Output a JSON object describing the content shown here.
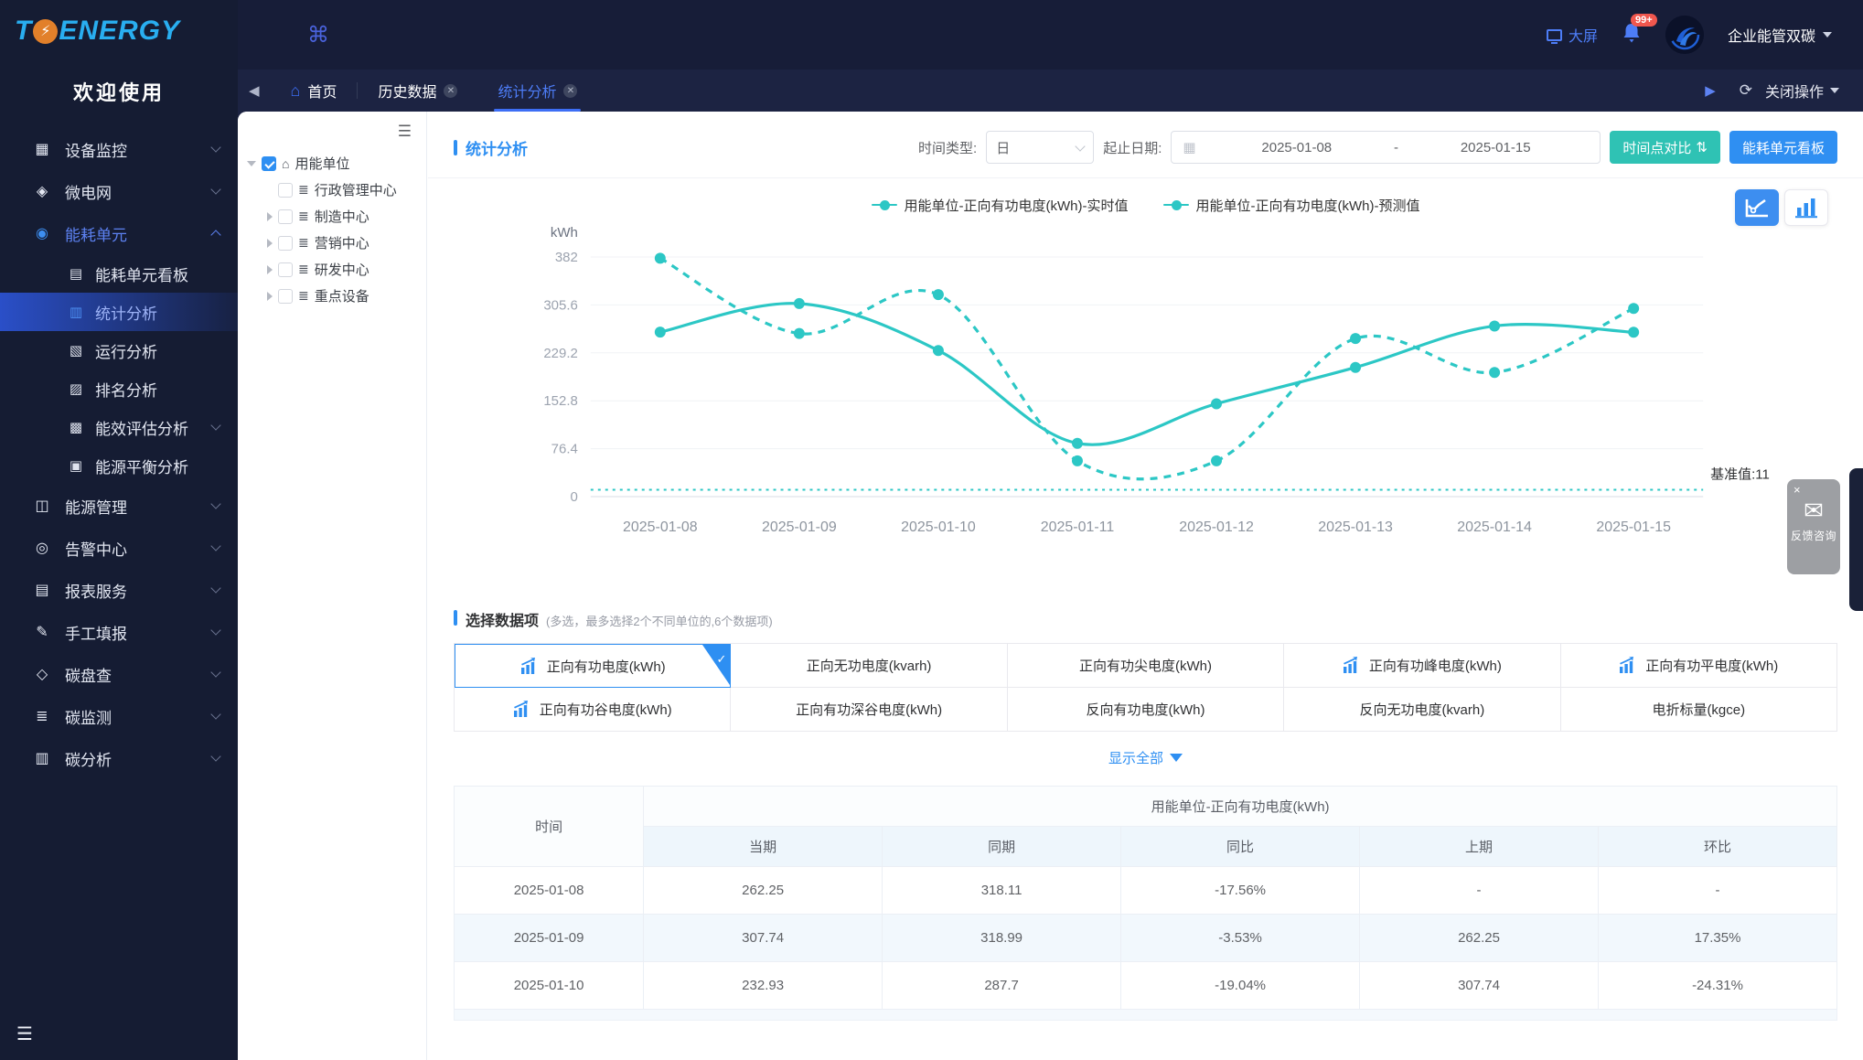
{
  "colors": {
    "accent_blue": "#2e8ff2",
    "teal": "#2cc7c5",
    "teal_button": "#2fc2b4",
    "sidebar_bg": "#151c33",
    "topbar_bg": "#171d38",
    "tabbar_bg": "#1c2342",
    "active_tab": "#4d7df7",
    "green": "#23a455",
    "red": "#e25050",
    "badge_red": "#f0574e"
  },
  "brand": {
    "logo_left": "T",
    "logo_bolt": "⚡",
    "logo_right": "ENERGY",
    "welcome": "欢迎使用"
  },
  "sidebar": {
    "collapse_icon": "☰",
    "items": [
      {
        "key": "device-monitor",
        "label": "设备监控",
        "icon": "▦",
        "chevron": "down"
      },
      {
        "key": "microgrid",
        "label": "微电网",
        "icon": "◈",
        "chevron": "down"
      },
      {
        "key": "energy-unit",
        "label": "能耗单元",
        "icon": "◉",
        "chevron": "up",
        "active": true,
        "children": [
          {
            "key": "energy-unit-board",
            "label": "能耗单元看板",
            "icon": "▤"
          },
          {
            "key": "statistical-analysis",
            "label": "统计分析",
            "icon": "▥",
            "active": true
          },
          {
            "key": "operation-analysis",
            "label": "运行分析",
            "icon": "▧"
          },
          {
            "key": "ranking-analysis",
            "label": "排名分析",
            "icon": "▨"
          },
          {
            "key": "efficiency-evaluation",
            "label": "能效评估分析",
            "icon": "▩",
            "chevron": "down"
          },
          {
            "key": "energy-balance",
            "label": "能源平衡分析",
            "icon": "▣"
          }
        ]
      },
      {
        "key": "energy-management",
        "label": "能源管理",
        "icon": "◫",
        "chevron": "down"
      },
      {
        "key": "alarm-center",
        "label": "告警中心",
        "icon": "◎",
        "chevron": "down"
      },
      {
        "key": "report-service",
        "label": "报表服务",
        "icon": "▤",
        "chevron": "down"
      },
      {
        "key": "manual-fill",
        "label": "手工填报",
        "icon": "✎",
        "chevron": "down"
      },
      {
        "key": "carbon-inventory",
        "label": "碳盘查",
        "icon": "◇",
        "chevron": "down"
      },
      {
        "key": "carbon-monitor",
        "label": "碳监测",
        "icon": "≣",
        "chevron": "down"
      },
      {
        "key": "carbon-analysis",
        "label": "碳分析",
        "icon": "▥",
        "chevron": "down"
      }
    ]
  },
  "topbar": {
    "apps_icon": "⌘",
    "big_screen": "大屏",
    "notification_badge": "99+",
    "org_name": "企业能管双碳"
  },
  "tabbar": {
    "back_icon": "◀",
    "forward_icon": "▶",
    "refresh_icon": "⟳",
    "home_label": "首页",
    "tabs": [
      {
        "label": "历史数据",
        "closable": true,
        "active": false
      },
      {
        "label": "统计分析",
        "closable": true,
        "active": true
      }
    ],
    "close_ops_label": "关闭操作"
  },
  "tree": {
    "collapse_icon": "☰",
    "root": {
      "key": "energy-consumer-unit",
      "label": "用能单位",
      "checked": true,
      "icon": "⌂"
    },
    "children": [
      {
        "key": "admin-center",
        "label": "行政管理中心",
        "expandable": false
      },
      {
        "key": "manufacturing-center",
        "label": "制造中心",
        "expandable": true
      },
      {
        "key": "marketing-center",
        "label": "营销中心",
        "expandable": true
      },
      {
        "key": "rd-center",
        "label": "研发中心",
        "expandable": true
      },
      {
        "key": "key-equipment",
        "label": "重点设备",
        "expandable": true
      }
    ],
    "child_icon": "≣"
  },
  "panel": {
    "title": "统计分析",
    "filters": {
      "time_type_label": "时间类型:",
      "time_type_value": "日",
      "range_label": "起止日期:",
      "calendar_icon": "▦",
      "date_from": "2025-01-08",
      "date_separator": "-",
      "date_to": "2025-01-15",
      "compare_button": "时间点对比",
      "compare_button_icon": "⇅",
      "board_button": "能耗单元看板"
    }
  },
  "chart_data": {
    "type": "line",
    "unit_label": "kWh",
    "x": [
      "2025-01-08",
      "2025-01-09",
      "2025-01-10",
      "2025-01-11",
      "2025-01-12",
      "2025-01-13",
      "2025-01-14",
      "2025-01-15"
    ],
    "yticks": [
      0,
      76.4,
      152.8,
      229.2,
      305.6,
      382
    ],
    "ylim": [
      0,
      382
    ],
    "series": [
      {
        "name": "用能单位-正向有功电度(kWh)-实时值",
        "style": "solid",
        "values": [
          262.25,
          307.74,
          232.93,
          85,
          148,
          206,
          272,
          262
        ]
      },
      {
        "name": "用能单位-正向有功电度(kWh)-预测值",
        "style": "dashed",
        "values": [
          380,
          260,
          322,
          57,
          57,
          252,
          198,
          300
        ]
      }
    ],
    "baseline": {
      "label": "基准值:11",
      "value": 11
    },
    "color": "#2cc7c5",
    "grid": true,
    "legend_position": "top"
  },
  "data_items": {
    "title": "选择数据项",
    "note": "(多选，最多选择2个不同单位的,6个数据项)",
    "show_all_label": "显示全部",
    "options": [
      {
        "key": "forward-active",
        "label": "正向有功电度(kWh)",
        "selected": true,
        "icon": true
      },
      {
        "key": "forward-reactive",
        "label": "正向无功电度(kvarh)",
        "selected": false,
        "icon": false
      },
      {
        "key": "forward-active-sharp",
        "label": "正向有功尖电度(kWh)",
        "selected": false,
        "icon": false
      },
      {
        "key": "forward-active-peak",
        "label": "正向有功峰电度(kWh)",
        "selected": false,
        "icon": true
      },
      {
        "key": "forward-active-flat",
        "label": "正向有功平电度(kWh)",
        "selected": false,
        "icon": true
      },
      {
        "key": "forward-active-valley",
        "label": "正向有功谷电度(kWh)",
        "selected": false,
        "icon": true
      },
      {
        "key": "forward-active-deep-valley",
        "label": "正向有功深谷电度(kWh)",
        "selected": false,
        "icon": false
      },
      {
        "key": "reverse-active",
        "label": "反向有功电度(kWh)",
        "selected": false,
        "icon": false
      },
      {
        "key": "reverse-reactive",
        "label": "反向无功电度(kvarh)",
        "selected": false,
        "icon": false
      },
      {
        "key": "coal-equivalent",
        "label": "电折标量(kgce)",
        "selected": false,
        "icon": false
      }
    ]
  },
  "table": {
    "time_header": "时间",
    "group_header": "用能单位-正向有功电度(kWh)",
    "columns": [
      "当期",
      "同期",
      "同比",
      "上期",
      "环比"
    ],
    "rows": [
      {
        "time": "2025-01-08",
        "cells": [
          {
            "v": "262.25"
          },
          {
            "v": "318.11"
          },
          {
            "v": "-17.56%",
            "c": "green"
          },
          {
            "v": "-"
          },
          {
            "v": "-"
          }
        ]
      },
      {
        "time": "2025-01-09",
        "cells": [
          {
            "v": "307.74"
          },
          {
            "v": "318.99"
          },
          {
            "v": "-3.53%",
            "c": "green"
          },
          {
            "v": "262.25"
          },
          {
            "v": "17.35%",
            "c": "red"
          }
        ]
      },
      {
        "time": "2025-01-10",
        "cells": [
          {
            "v": "232.93"
          },
          {
            "v": "287.7"
          },
          {
            "v": "-19.04%",
            "c": "green"
          },
          {
            "v": "307.74"
          },
          {
            "v": "-24.31%",
            "c": "green"
          }
        ]
      }
    ],
    "partial_row": true
  },
  "feedback": {
    "close_icon": "×",
    "envelope_icon": "✉",
    "label": "反馈咨询"
  }
}
